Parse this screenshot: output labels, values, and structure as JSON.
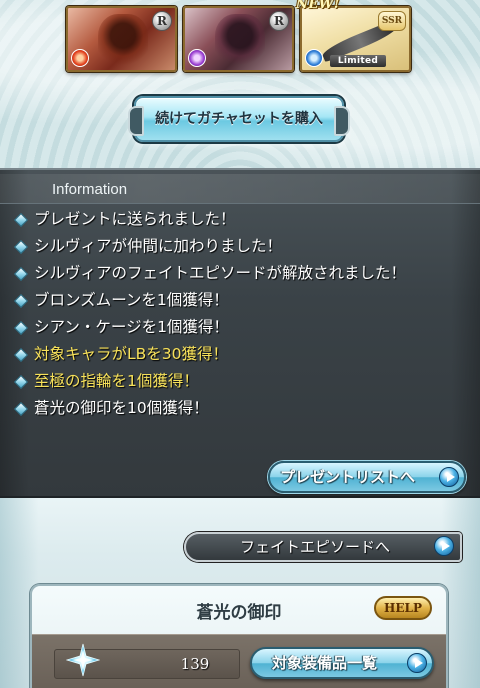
{
  "gacha_results": {
    "cards": [
      {
        "rarity": "R",
        "element": "fire"
      },
      {
        "rarity": "R",
        "element": "dark"
      },
      {
        "rarity": "SSR",
        "element": "water",
        "badge": "Limited",
        "new_label": "NEW!"
      }
    ],
    "buy_button_label": "続けてガチャセットを購入"
  },
  "information": {
    "title": "Information",
    "items": [
      {
        "text": "プレゼントに送られました！",
        "highlight": false
      },
      {
        "text": "シルヴィアが仲間に加わりました！",
        "highlight": false
      },
      {
        "text": "シルヴィアのフェイトエピソードが解放されました！",
        "highlight": false
      },
      {
        "text": "ブロンズムーンを1個獲得！",
        "highlight": false
      },
      {
        "text": "シアン・ケージを1個獲得！",
        "highlight": false
      },
      {
        "text": "対象キャラがLBを30獲得！",
        "highlight": true
      },
      {
        "text": "至極の指輪を1個獲得！",
        "highlight": true
      },
      {
        "text": "蒼光の御印を10個獲得！",
        "highlight": false
      }
    ],
    "present_list_button": "プレゼントリストへ"
  },
  "fate_episode_button": "フェイトエピソードへ",
  "seal_panel": {
    "title": "蒼光の御印",
    "help_label": "HELP",
    "count": "139",
    "equip_list_button": "対象装備品一覧"
  },
  "colors": {
    "highlight_text": "#f7e15a",
    "panel_dark": "#3a4247",
    "button_blue": "#8ad3ea"
  }
}
